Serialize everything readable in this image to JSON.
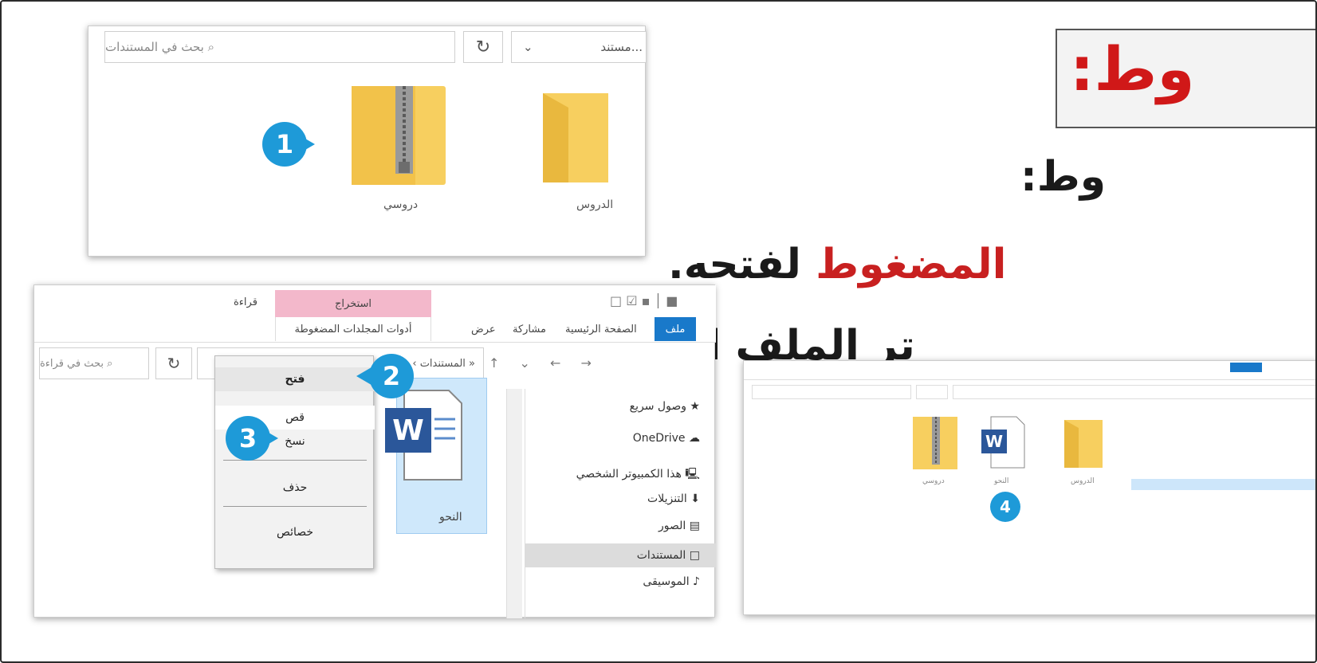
{
  "heading": {
    "title": "وط:",
    "line1": "وط:",
    "line2_red": "المضغوط",
    "line2_black": "لفتحه.",
    "line3": "تر الملف الذي تريد."
  },
  "panel_top": {
    "search_placeholder": "بحث في المستندات",
    "crumb_label": "مستند...",
    "folders": [
      {
        "label": "دروسي",
        "icon": "zip-folder-icon"
      },
      {
        "label": "الدروس",
        "icon": "folder-icon"
      }
    ],
    "badge": "1"
  },
  "panel_bottom": {
    "ribbon": {
      "extract_tab": "استخراج",
      "zip_tools_tab": "أدوات المجلدات المضغوطة",
      "read_label": "قراءة",
      "tabs": [
        "ملف",
        "الصفحة الرئيسية",
        "مشاركة",
        "عرض"
      ]
    },
    "search_placeholder": "بحث في قراءة",
    "path": "« المستندات › دروسي › دروسي › الدروس › قراءة",
    "sidebar": [
      "وصول سريع",
      "OneDrive",
      "هذا الكمبيوتر الشخصي",
      "التنزيلات",
      "الصور",
      "المستندات",
      "الموسيقى"
    ],
    "file_label": "النحو",
    "context_menu": [
      "فتح",
      "قص",
      "نسخ",
      "حذف",
      "خصائص"
    ],
    "badges": [
      "2",
      "3"
    ]
  },
  "panel_mini": {
    "badge": "4",
    "labels": [
      "دروسي",
      "النحو",
      "الدروس"
    ]
  },
  "colors": {
    "accent_blue": "#1e9ad8",
    "heading_red": "#d01818",
    "ribbon_blue": "#1979ca",
    "extract_pink": "#f3b8cb"
  }
}
